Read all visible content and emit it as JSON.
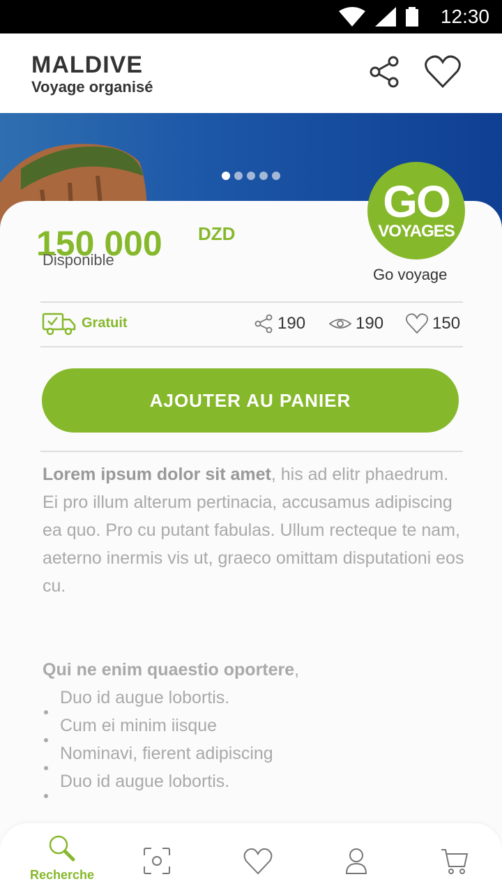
{
  "status_bar": {
    "time": "12:30"
  },
  "header": {
    "title": "MALDIVE",
    "subtitle": "Voyage organisé"
  },
  "carousel": {
    "dots": 5,
    "active_index": 0
  },
  "product": {
    "price": "150 000",
    "currency": "DZD",
    "availability": "Disponible",
    "vendor_logo_top": "GO",
    "vendor_logo_bottom": "VOYAGES",
    "vendor": "Go voyage"
  },
  "stats": {
    "shipping": "Gratuit",
    "shares": "190",
    "views": "190",
    "likes": "150"
  },
  "cta": {
    "label": "AJOUTER AU PANIER"
  },
  "description": {
    "lead_bold": "Lorem ipsum dolor sit amet",
    "lead_rest": ", his ad elitr phaedrum. Ei pro illum alterum pertinacia, accusamus adipiscing ea quo. Pro cu putant fabulas. Ullum recteque te nam, aeterno inermis vis ut, graeco omittam disputationi eos cu.",
    "section_bold": "Qui ne enim quaestio oportere",
    "section_rest": ",",
    "items": [
      "Duo id augue lobortis.",
      "Cum ei minim iisque",
      "Nominavi, fierent adipiscing",
      "Duo id augue lobortis."
    ]
  },
  "bottom_nav": {
    "search_label": "Recherche"
  },
  "colors": {
    "accent": "#86b82b",
    "text": "#333333",
    "muted": "#a9a9a9"
  }
}
